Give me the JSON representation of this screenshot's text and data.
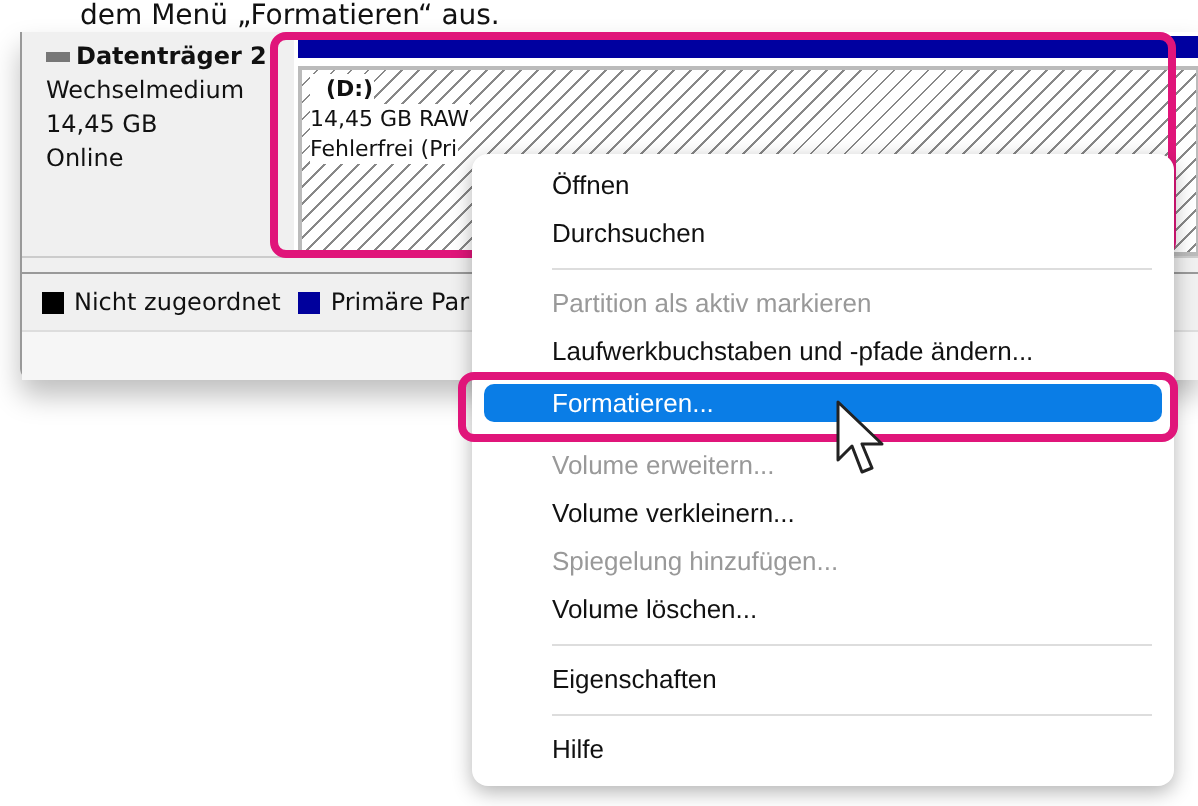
{
  "caption": "dem Menü „Formatieren“ aus.",
  "disk": {
    "name": "Datenträger 2",
    "type": "Wechselmedium",
    "size": "14,45 GB",
    "status": "Online"
  },
  "partition": {
    "letter": "(D:)",
    "size": "14,45 GB RAW",
    "status": "Fehlerfrei (Pri"
  },
  "legend": [
    {
      "label": "Nicht zugeordnet",
      "color": "#000000"
    },
    {
      "label": "Primäre Par",
      "color": "#00009c"
    }
  ],
  "context_menu": [
    {
      "kind": "item",
      "label": "Öffnen",
      "disabled": false,
      "selected": false
    },
    {
      "kind": "item",
      "label": "Durchsuchen",
      "disabled": false,
      "selected": false
    },
    {
      "kind": "separator"
    },
    {
      "kind": "item",
      "label": "Partition als aktiv markieren",
      "disabled": true,
      "selected": false
    },
    {
      "kind": "item",
      "label": "Laufwerkbuchstaben und -pfade ändern...",
      "disabled": false,
      "selected": false
    },
    {
      "kind": "item",
      "label": "Formatieren...",
      "disabled": false,
      "selected": true
    },
    {
      "kind": "item",
      "label": "Volume erweitern...",
      "disabled": true,
      "selected": false
    },
    {
      "kind": "item",
      "label": "Volume verkleinern...",
      "disabled": false,
      "selected": false
    },
    {
      "kind": "item",
      "label": "Spiegelung hinzufügen...",
      "disabled": true,
      "selected": false
    },
    {
      "kind": "item",
      "label": "Volume löschen...",
      "disabled": false,
      "selected": false
    },
    {
      "kind": "separator"
    },
    {
      "kind": "item",
      "label": "Eigenschaften",
      "disabled": false,
      "selected": false
    },
    {
      "kind": "separator"
    },
    {
      "kind": "item",
      "label": "Hilfe",
      "disabled": false,
      "selected": false
    }
  ]
}
